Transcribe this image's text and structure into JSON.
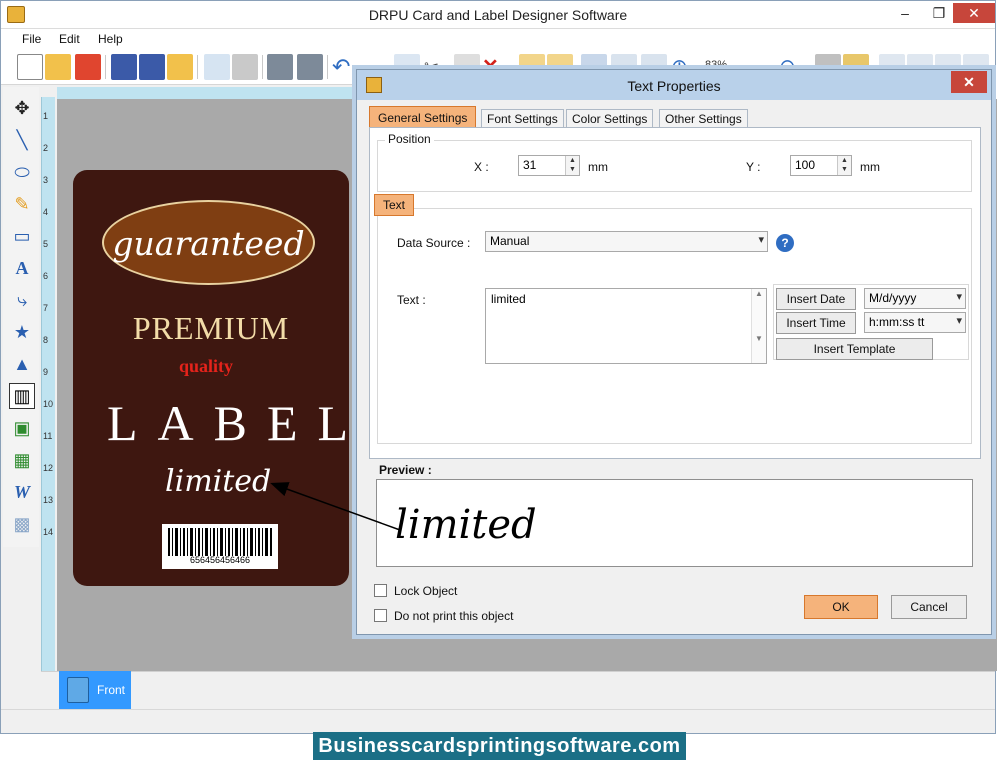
{
  "window": {
    "title": "DRPU Card and Label Designer Software",
    "controls": {
      "minimize": "–",
      "maximize": "❐",
      "close": "✕"
    }
  },
  "menu": [
    "File",
    "Edit",
    "Help"
  ],
  "toolbar": {
    "zoom": "83%"
  },
  "left_tools": [
    "move-tool",
    "line-tool",
    "ellipse-tool",
    "pencil-tool",
    "rectangle-tool",
    "text-tool",
    "arc-tool",
    "star-tool",
    "triangle-tool",
    "barcode-tool",
    "image-tool",
    "library-image-tool",
    "wordart-tool",
    "watermark-tool"
  ],
  "ruler": {
    "v_numbers": [
      "1",
      "2",
      "3",
      "4",
      "5",
      "6",
      "7",
      "8",
      "9",
      "10",
      "11",
      "12",
      "13",
      "14"
    ]
  },
  "card": {
    "oval_text": "guaranteed",
    "premium": "PREMIUM",
    "quality": "quality",
    "label": "LABEL",
    "limited": "limited",
    "barcode_number": "656456456466",
    "colors": {
      "background": "#3e1710",
      "oval": "#7f3e12",
      "quality": "#e5231b",
      "premium": "#f2dca8"
    }
  },
  "page_tabs": [
    {
      "label": "Front"
    }
  ],
  "dialog": {
    "title": "Text Properties",
    "close": "✕",
    "tabs": [
      "General Settings",
      "Font Settings",
      "Color Settings",
      "Other Settings"
    ],
    "position": {
      "group_title": "Position",
      "x_label": "X :",
      "x_value": "31",
      "x_unit": "mm",
      "y_label": "Y :",
      "y_value": "100",
      "y_unit": "mm"
    },
    "text_group": {
      "title": "Text",
      "data_source_label": "Data Source :",
      "data_source_value": "Manual",
      "help": "?",
      "text_label": "Text :",
      "text_value": "limited",
      "insert_date": "Insert Date",
      "date_format": "M/d/yyyy",
      "insert_time": "Insert Time",
      "time_format": "h:mm:ss tt",
      "insert_template": "Insert Template"
    },
    "preview_label": "Preview :",
    "preview_text": "limited",
    "lock_object": "Lock Object",
    "do_not_print": "Do not print this object",
    "ok": "OK",
    "cancel": "Cancel",
    "accent_color": "#f5b37b"
  },
  "watermark": "Businesscardsprintingsoftware.com"
}
